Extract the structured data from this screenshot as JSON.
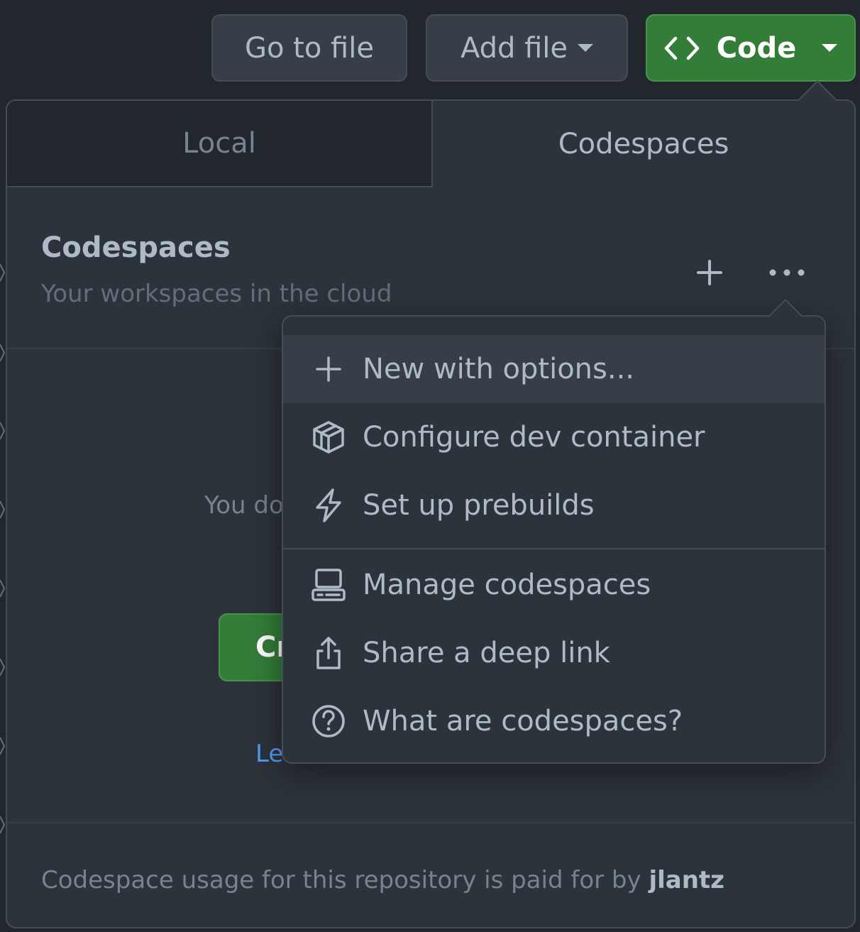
{
  "toolbar": {
    "go_to_file": "Go to file",
    "add_file": "Add file",
    "code": "Code"
  },
  "popover": {
    "tabs": [
      {
        "label": "Local",
        "selected": false
      },
      {
        "label": "Codespaces",
        "selected": true
      }
    ],
    "header": {
      "title": "Codespaces",
      "subtitle": "Your workspaces in the cloud"
    },
    "body": {
      "empty_text": "You do",
      "create_button": "Cr",
      "learn_link": "Lea"
    },
    "footer": {
      "text": "Codespace usage for this repository is paid for by ",
      "owner": "jlantz"
    }
  },
  "menu": {
    "items": [
      {
        "label": "New with options...",
        "icon": "plus-icon"
      },
      {
        "label": "Configure dev container",
        "icon": "container-icon"
      },
      {
        "label": "Set up prebuilds",
        "icon": "zap-icon"
      },
      {
        "label": "Manage codespaces",
        "icon": "codespaces-icon"
      },
      {
        "label": "Share a deep link",
        "icon": "share-icon"
      },
      {
        "label": "What are codespaces?",
        "icon": "question-icon"
      }
    ]
  },
  "colors": {
    "background": "#22272e",
    "overlay": "#2d333b",
    "border": "#444c56",
    "primary_button": "#347d39",
    "link": "#539bf5"
  }
}
